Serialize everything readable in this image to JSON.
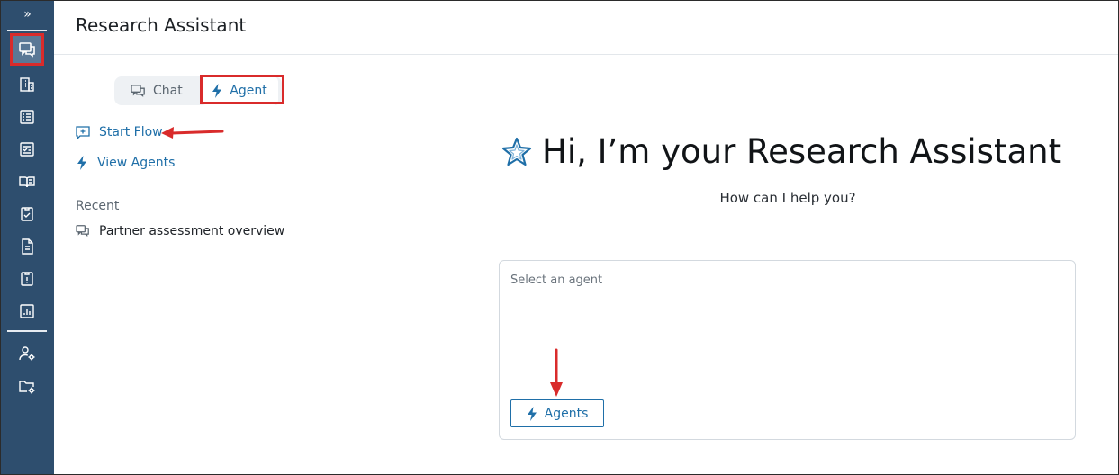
{
  "header": {
    "title": "Research Assistant"
  },
  "rail": {
    "expand_glyph": "»",
    "items": [
      {
        "icon": "chat-bubbles-icon",
        "active": true
      },
      {
        "icon": "building-icon"
      },
      {
        "icon": "list-icon"
      },
      {
        "icon": "checklist-icon"
      },
      {
        "icon": "book-icon"
      },
      {
        "icon": "document-check-icon"
      },
      {
        "icon": "document-icon"
      },
      {
        "icon": "clipboard-alert-icon"
      },
      {
        "icon": "report-chart-icon"
      },
      {
        "icon": "user-settings-icon"
      },
      {
        "icon": "folder-settings-icon"
      }
    ]
  },
  "panel": {
    "toggle": {
      "chat_label": "Chat",
      "agent_label": "Agent",
      "selected": "Agent"
    },
    "links": {
      "start_flow": "Start Flow",
      "view_agents": "View Agents"
    },
    "recent_label": "Recent",
    "recent_items": [
      "Partner assessment overview"
    ]
  },
  "main": {
    "greeting": "Hi, I’m your Research Assistant",
    "subtitle": "How can I help you?",
    "composer": {
      "placeholder": "Select an agent",
      "agents_button": "Agents"
    }
  },
  "colors": {
    "rail": "#2e4e6e",
    "accent": "#1f6fa8",
    "annotation": "#d92b2b"
  }
}
